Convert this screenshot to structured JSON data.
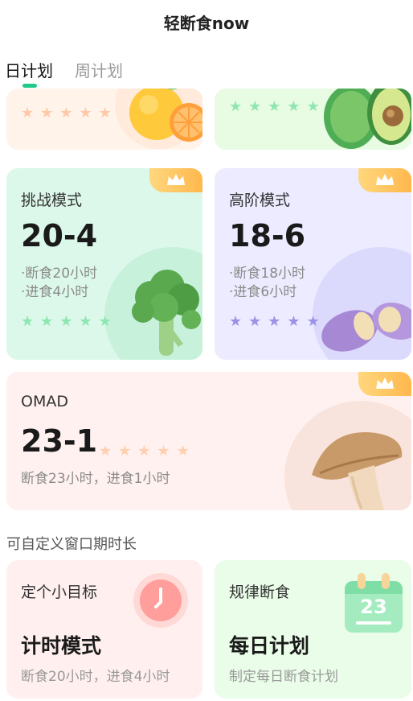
{
  "header": {
    "title": "轻断食now"
  },
  "tabs": [
    {
      "label": "日计划",
      "active": true
    },
    {
      "label": "周计划",
      "active": false
    }
  ],
  "accent_color": "#22c98a",
  "partial_cards": [
    {
      "icon": "orange-icon",
      "stars": 5,
      "star_color": "#ffc9a8"
    },
    {
      "icon": "avocado-icon",
      "stars": 5,
      "star_color": "#8ee6b0"
    }
  ],
  "modes": {
    "challenge": {
      "name": "挑战模式",
      "ratio": "20-4",
      "desc1": "·断食20小时",
      "desc2": "·进食4小时",
      "stars": 5,
      "icon": "broccoli-icon",
      "premium": true
    },
    "advanced": {
      "name": "高阶模式",
      "ratio": "18-6",
      "desc1": "·断食18小时",
      "desc2": "·进食6小时",
      "stars": 5,
      "icon": "sweet-potato-icon",
      "premium": true
    },
    "omad": {
      "name": "OMAD",
      "ratio": "23-1",
      "desc": "断食23小时，进食1小时",
      "stars": 5,
      "icon": "mushroom-icon",
      "premium": true
    }
  },
  "custom_section": {
    "label": "可自定义窗口期时长"
  },
  "custom_cards": {
    "timer": {
      "subtitle": "定个小目标",
      "title": "计时模式",
      "desc": "断食20小时，进食4小时",
      "icon": "clock-icon"
    },
    "daily": {
      "subtitle": "规律断食",
      "title": "每日计划",
      "desc": "制定每日断食计划",
      "icon": "calendar-icon",
      "calendar_day": "23"
    }
  }
}
